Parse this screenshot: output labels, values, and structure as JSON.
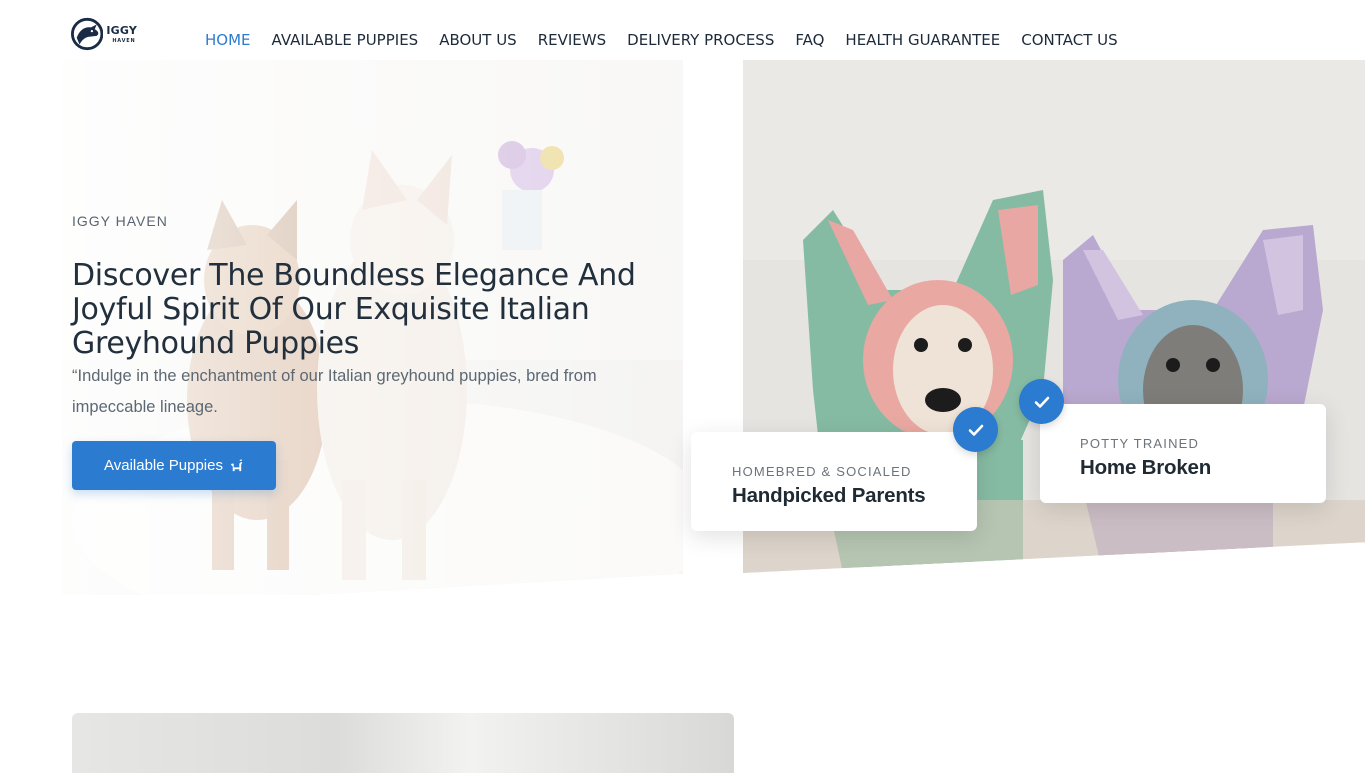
{
  "brand": {
    "logo_word": "IGGY",
    "logo_sub": "HAVEN",
    "logo_icon": "greyhound-head-icon"
  },
  "nav": {
    "items": [
      {
        "label": "HOME",
        "active": true
      },
      {
        "label": "AVAILABLE PUPPIES",
        "active": false
      },
      {
        "label": "ABOUT US",
        "active": false
      },
      {
        "label": "REVIEWS",
        "active": false
      },
      {
        "label": "DELIVERY PROCESS",
        "active": false
      },
      {
        "label": "FAQ",
        "active": false
      },
      {
        "label": "HEALTH GUARANTEE",
        "active": false
      },
      {
        "label": "CONTACT US",
        "active": false
      }
    ]
  },
  "hero": {
    "eyebrow": "IGGY HAVEN",
    "title": "Discover The Boundless Elegance And Joyful Spirit Of Our Exquisite Italian Greyhound Puppies",
    "description": "“Indulge in the enchantment of our Italian greyhound puppies, bred from impeccable lineage.",
    "cta_label": "Available Puppies",
    "cta_icon": "dog-icon"
  },
  "features": [
    {
      "eyebrow": "HOMEBRED & SOCIALED",
      "title": "Handpicked Parents",
      "icon": "check-icon"
    },
    {
      "eyebrow": "POTTY TRAINED",
      "title": "Home Broken",
      "icon": "check-icon"
    }
  ],
  "colors": {
    "accent": "#2b7bd1",
    "text_dark": "#1f2a33",
    "text_muted": "#5c6873"
  }
}
